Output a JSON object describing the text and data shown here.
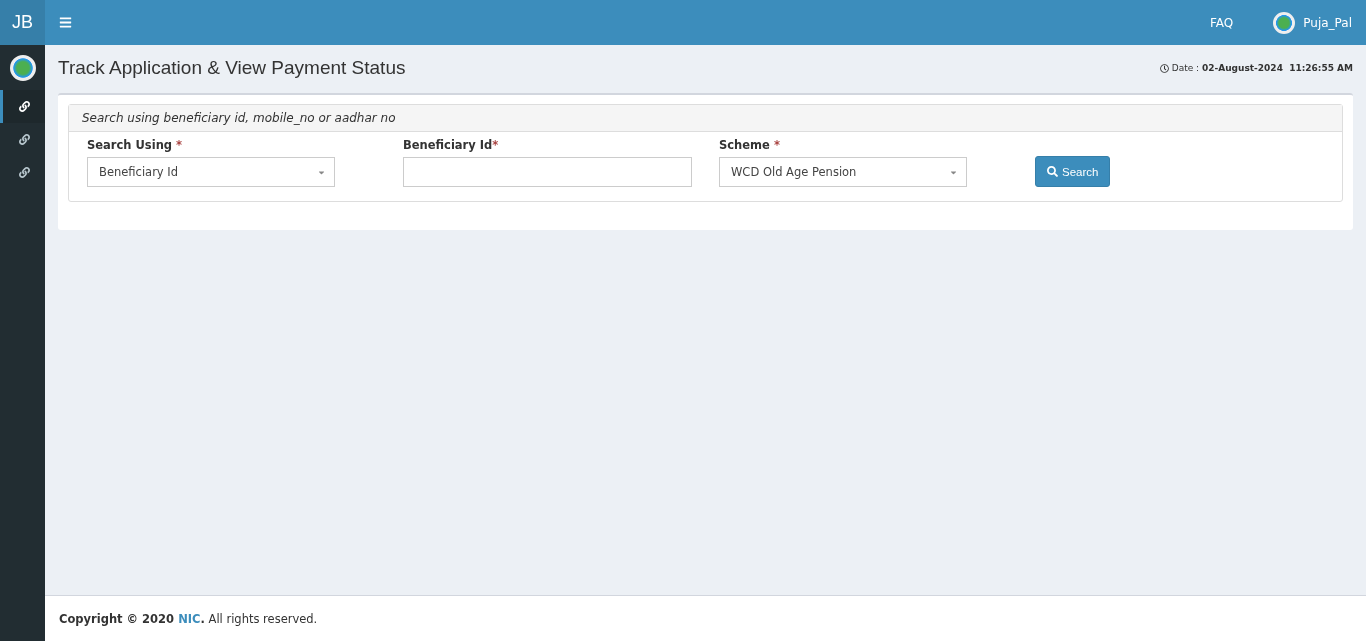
{
  "brand": "JB",
  "topbar": {
    "faq": "FAQ",
    "user": "Puja_Pal"
  },
  "sidebar": {
    "items": [
      {
        "selected": true
      },
      {
        "selected": false
      },
      {
        "selected": false
      }
    ]
  },
  "page": {
    "title": "Track Application & View Payment Status",
    "date": "Date : **02-August-2024  11:26:55 AM**"
  },
  "panel": {
    "heading": "Search using beneficiary id, mobile_no or aadhar no",
    "fields": [
      {
        "kind": "select",
        "label": "Search Using",
        "required_mark": " *",
        "value": "Beneficiary Id"
      },
      {
        "kind": "input",
        "label": "Beneficiary Id",
        "required_mark": "*"
      },
      {
        "kind": "select",
        "label": "Scheme",
        "required_mark": " *",
        "value": "WCD Old Age Pension"
      }
    ],
    "button": "Search"
  },
  "footer": {
    "prefix": "Copyright © 2020",
    "link": "NIC",
    "suffix": "**.** All rights reserved."
  }
}
